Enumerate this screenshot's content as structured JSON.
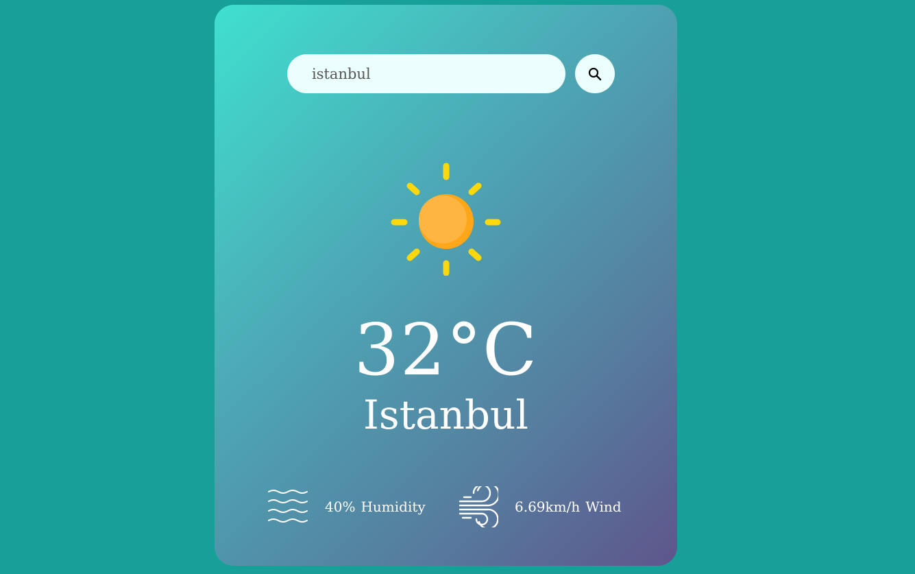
{
  "search": {
    "value": "istanbul",
    "button_icon": "search-icon"
  },
  "weather": {
    "icon": "sun-icon",
    "temperature": "32°C",
    "city": "Istanbul"
  },
  "details": {
    "humidity": {
      "icon": "humidity-waves-icon",
      "value": "40%",
      "label": "Humidity"
    },
    "wind": {
      "icon": "wind-icon",
      "value": "6.69km/h",
      "label": "Wind"
    }
  },
  "colors": {
    "page_background": "#17a099",
    "card_gradient_start": "#3fe0d0",
    "card_gradient_end": "#5e558c",
    "input_background": "#ebfffc",
    "sun_core": "#ffb541",
    "sun_rays": "#ffd80b"
  }
}
